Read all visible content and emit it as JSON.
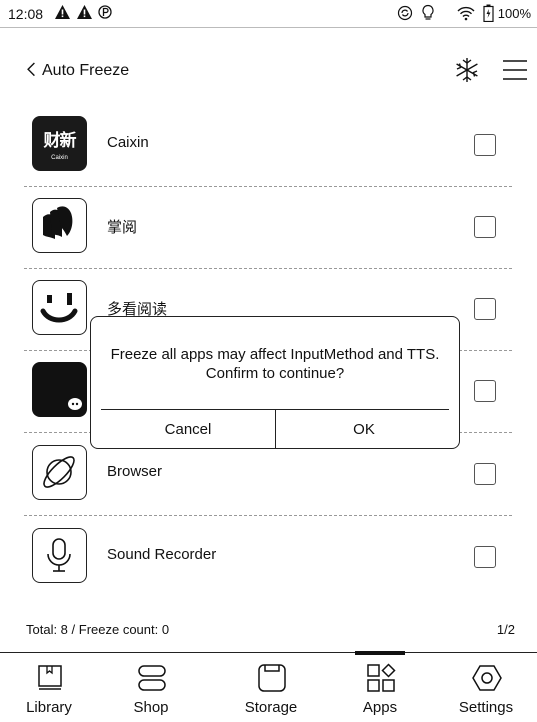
{
  "status": {
    "time": "12:08",
    "battery": "100%",
    "icons": [
      "warning-icon",
      "warning-icon",
      "parking-icon",
      "sync-icon",
      "bulb-icon",
      "wifi-icon",
      "battery-icon"
    ]
  },
  "header": {
    "title": "Auto Freeze",
    "icons": [
      "back-icon",
      "snowflake-icon",
      "menu-icon"
    ]
  },
  "apps": [
    {
      "name": "Caixin",
      "icon_name": "caixin-icon",
      "icon_text": "财新",
      "icon_subtext": "Caixin"
    },
    {
      "name": "掌阅",
      "icon_name": "ireader-icon"
    },
    {
      "name": "多看阅读",
      "icon_name": "duokan-icon"
    },
    {
      "name": "",
      "icon_name": "chat-app-icon"
    },
    {
      "name": "Browser",
      "icon_name": "planet-icon"
    },
    {
      "name": "Sound Recorder",
      "icon_name": "microphone-icon"
    }
  ],
  "footer": {
    "summary": "Total: 8 / Freeze count: 0",
    "page": "1/2"
  },
  "tabs": [
    {
      "label": "Library",
      "icon": "book-icon",
      "active": false
    },
    {
      "label": "Shop",
      "icon": "shop-icon",
      "active": false
    },
    {
      "label": "Storage",
      "icon": "storage-icon",
      "active": false
    },
    {
      "label": "Apps",
      "icon": "apps-icon",
      "active": true
    },
    {
      "label": "Settings",
      "icon": "settings-icon",
      "active": false
    }
  ],
  "dialog": {
    "message": "Freeze all apps may affect InputMethod and TTS. Confirm to continue?",
    "cancel": "Cancel",
    "ok": "OK"
  }
}
